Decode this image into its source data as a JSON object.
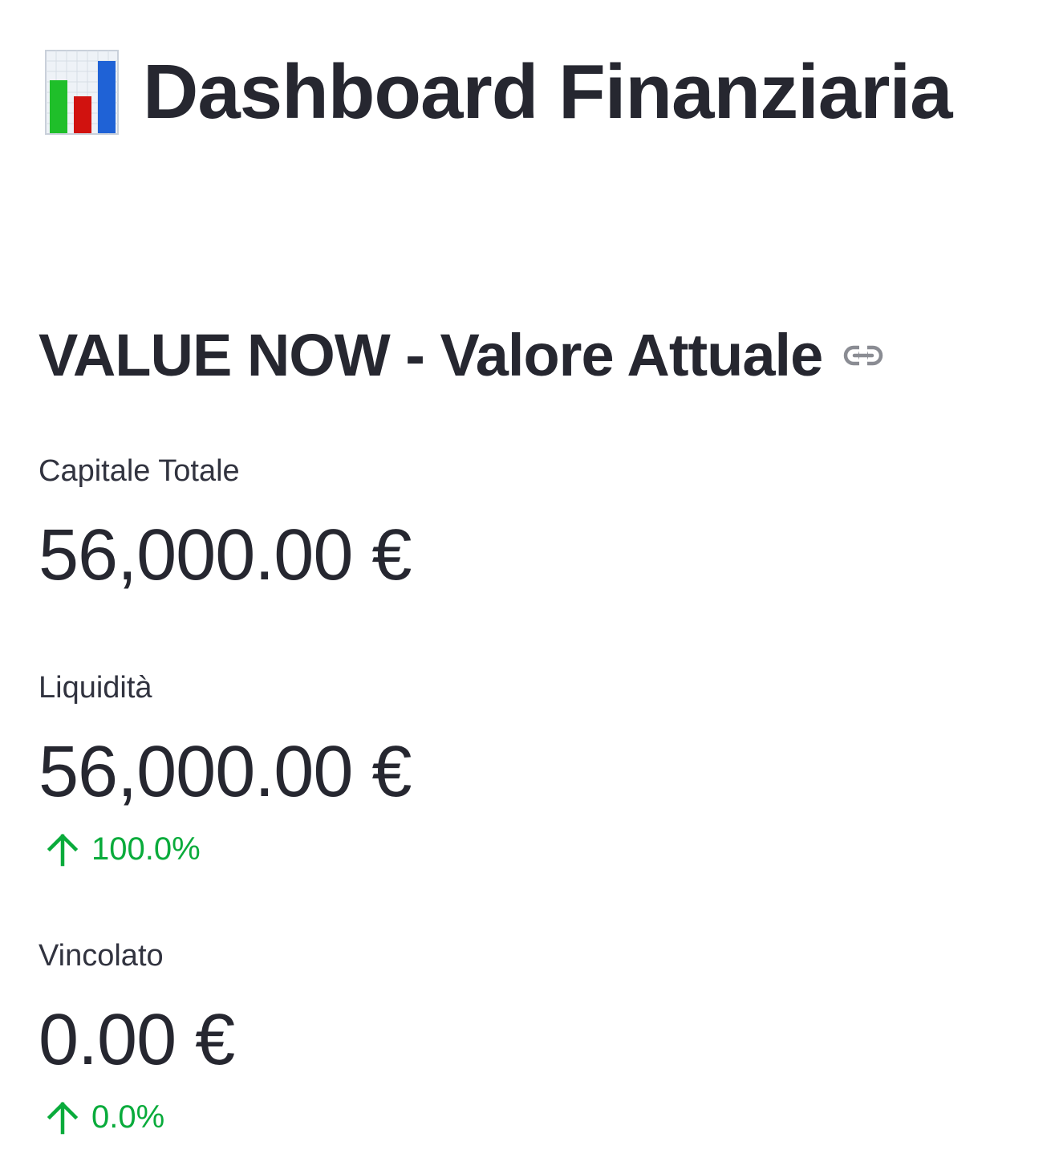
{
  "header": {
    "emoji_icon": "bar-chart-emoji",
    "title": "Dashboard Finanziaria"
  },
  "section": {
    "title": "VALUE NOW - Valore Attuale",
    "anchor_icon": "link-icon"
  },
  "metrics": [
    {
      "label": "Capitale Totale",
      "value": "56,000.00 €",
      "delta": null
    },
    {
      "label": "Liquidità",
      "value": "56,000.00 €",
      "delta": "100.0%",
      "delta_direction": "up"
    },
    {
      "label": "Vincolato",
      "value": "0.00 €",
      "delta": "0.0%",
      "delta_direction": "up"
    }
  ],
  "colors": {
    "text": "#262730",
    "delta_positive": "#09ab3b",
    "background": "#ffffff"
  }
}
